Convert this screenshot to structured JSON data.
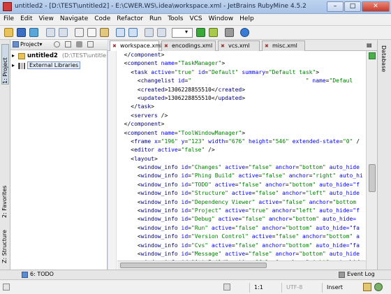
{
  "window": {
    "title": "untitled2 - [D:\\TEST\\untitled2] - E:\\CWER.WS\\.idea\\workspace.xml - JetBrains RubyMine 4.5.2",
    "min": "–",
    "max": "□",
    "close": "✕"
  },
  "menu": [
    "File",
    "Edit",
    "View",
    "Navigate",
    "Code",
    "Refactor",
    "Run",
    "Tools",
    "VCS",
    "Window",
    "Help"
  ],
  "project_panel": {
    "dropdown": "Project▾",
    "root_name": "untitled2",
    "root_path": "(D:\\TEST\\untitle",
    "libraries": "External Libraries"
  },
  "left_tabs": {
    "project": "1: Project",
    "favorites": "2: Favorites",
    "structure": "Z: Structure"
  },
  "right_tabs": {
    "database": "Database"
  },
  "editor_tabs": [
    "workspace.xml",
    "encodings.xml",
    "vcs.xml",
    "misc.xml"
  ],
  "code_lines": [
    [
      [
        "  </",
        ""
      ],
      [
        "component",
        "t"
      ],
      [
        ">",
        ""
      ]
    ],
    [
      [
        "  <",
        ""
      ],
      [
        "component",
        "t"
      ],
      [
        " ",
        ""
      ],
      [
        "name",
        "a"
      ],
      [
        "=",
        ""
      ],
      [
        "\"TaskManager\"",
        "v"
      ],
      [
        ">",
        ""
      ]
    ],
    [
      [
        "    <",
        ""
      ],
      [
        "task",
        "t"
      ],
      [
        " ",
        ""
      ],
      [
        "active",
        "a"
      ],
      [
        "=",
        ""
      ],
      [
        "\"true\"",
        "v"
      ],
      [
        " ",
        ""
      ],
      [
        "id",
        "a"
      ],
      [
        "=",
        ""
      ],
      [
        "\"Default\"",
        "v"
      ],
      [
        " ",
        ""
      ],
      [
        "summary",
        "a"
      ],
      [
        "=",
        ""
      ],
      [
        "\"Default task\"",
        "v"
      ],
      [
        ">",
        ""
      ]
    ],
    [
      [
        "      <",
        ""
      ],
      [
        "changelist",
        "t"
      ],
      [
        " ",
        ""
      ],
      [
        "id",
        "a"
      ],
      [
        "=",
        ""
      ],
      [
        "\"                                  \"",
        "v"
      ],
      [
        " ",
        ""
      ],
      [
        "name",
        "a"
      ],
      [
        "=",
        ""
      ],
      [
        "\"Defaul",
        "v"
      ]
    ],
    [
      [
        "      <",
        ""
      ],
      [
        "created",
        "t"
      ],
      [
        ">1306228855510</",
        ""
      ],
      [
        "created",
        "t"
      ],
      [
        ">",
        ""
      ]
    ],
    [
      [
        "      <",
        ""
      ],
      [
        "updated",
        "t"
      ],
      [
        ">1306228855510</",
        ""
      ],
      [
        "updated",
        "t"
      ],
      [
        ">",
        ""
      ]
    ],
    [
      [
        "    </",
        ""
      ],
      [
        "task",
        "t"
      ],
      [
        ">",
        ""
      ]
    ],
    [
      [
        "    <",
        ""
      ],
      [
        "servers",
        "t"
      ],
      [
        " />",
        ""
      ]
    ],
    [
      [
        "  </",
        ""
      ],
      [
        "component",
        "t"
      ],
      [
        ">",
        ""
      ]
    ],
    [
      [
        "  <",
        ""
      ],
      [
        "component",
        "t"
      ],
      [
        " ",
        ""
      ],
      [
        "name",
        "a"
      ],
      [
        "=",
        ""
      ],
      [
        "\"ToolWindowManager\"",
        "v"
      ],
      [
        ">",
        ""
      ]
    ],
    [
      [
        "    <",
        ""
      ],
      [
        "frame",
        "t"
      ],
      [
        " ",
        ""
      ],
      [
        "x",
        "a"
      ],
      [
        "=",
        ""
      ],
      [
        "\"196\"",
        "v"
      ],
      [
        " ",
        ""
      ],
      [
        "y",
        "a"
      ],
      [
        "=",
        ""
      ],
      [
        "\"123\"",
        "v"
      ],
      [
        " ",
        ""
      ],
      [
        "width",
        "a"
      ],
      [
        "=",
        ""
      ],
      [
        "\"676\"",
        "v"
      ],
      [
        " ",
        ""
      ],
      [
        "height",
        "a"
      ],
      [
        "=",
        ""
      ],
      [
        "\"546\"",
        "v"
      ],
      [
        " ",
        ""
      ],
      [
        "extended-state",
        "a"
      ],
      [
        "=",
        ""
      ],
      [
        "\"0\"",
        "v"
      ],
      [
        " /",
        ""
      ]
    ],
    [
      [
        "    <",
        ""
      ],
      [
        "editor",
        "t"
      ],
      [
        " ",
        ""
      ],
      [
        "active",
        "a"
      ],
      [
        "=",
        ""
      ],
      [
        "\"false\"",
        "v"
      ],
      [
        " />",
        ""
      ]
    ],
    [
      [
        "    <",
        ""
      ],
      [
        "layout",
        "t"
      ],
      [
        ">",
        ""
      ]
    ],
    [
      [
        "      <",
        ""
      ],
      [
        "window_info",
        "t"
      ],
      [
        " ",
        ""
      ],
      [
        "id",
        "a"
      ],
      [
        "=",
        ""
      ],
      [
        "\"Changes\"",
        "v"
      ],
      [
        " ",
        ""
      ],
      [
        "active",
        "a"
      ],
      [
        "=",
        ""
      ],
      [
        "\"false\"",
        "v"
      ],
      [
        " ",
        ""
      ],
      [
        "anchor",
        "a"
      ],
      [
        "=",
        ""
      ],
      [
        "\"bottom\"",
        "v"
      ],
      [
        " ",
        ""
      ],
      [
        "auto_hide",
        "a"
      ]
    ],
    [
      [
        "      <",
        ""
      ],
      [
        "window_info",
        "t"
      ],
      [
        " ",
        ""
      ],
      [
        "id",
        "a"
      ],
      [
        "=",
        ""
      ],
      [
        "\"Phing Build\"",
        "v"
      ],
      [
        " ",
        ""
      ],
      [
        "active",
        "a"
      ],
      [
        "=",
        ""
      ],
      [
        "\"false\"",
        "v"
      ],
      [
        " ",
        ""
      ],
      [
        "anchor",
        "a"
      ],
      [
        "=",
        ""
      ],
      [
        "\"right\"",
        "v"
      ],
      [
        " ",
        ""
      ],
      [
        "auto_hi",
        "a"
      ]
    ],
    [
      [
        "      <",
        ""
      ],
      [
        "window_info",
        "t"
      ],
      [
        " ",
        ""
      ],
      [
        "id",
        "a"
      ],
      [
        "=",
        ""
      ],
      [
        "\"TODO\"",
        "v"
      ],
      [
        " ",
        ""
      ],
      [
        "active",
        "a"
      ],
      [
        "=",
        ""
      ],
      [
        "\"false\"",
        "v"
      ],
      [
        " ",
        ""
      ],
      [
        "anchor",
        "a"
      ],
      [
        "=",
        ""
      ],
      [
        "\"bottom\"",
        "v"
      ],
      [
        " ",
        ""
      ],
      [
        "auto_hide=\"f",
        "a"
      ]
    ],
    [
      [
        "      <",
        ""
      ],
      [
        "window_info",
        "t"
      ],
      [
        " ",
        ""
      ],
      [
        "id",
        "a"
      ],
      [
        "=",
        ""
      ],
      [
        "\"Structure\"",
        "v"
      ],
      [
        " ",
        ""
      ],
      [
        "active",
        "a"
      ],
      [
        "=",
        ""
      ],
      [
        "\"false\"",
        "v"
      ],
      [
        " ",
        ""
      ],
      [
        "anchor",
        "a"
      ],
      [
        "=",
        ""
      ],
      [
        "\"left\"",
        "v"
      ],
      [
        " ",
        ""
      ],
      [
        "auto_hide",
        "a"
      ]
    ],
    [
      [
        "      <",
        ""
      ],
      [
        "window_info",
        "t"
      ],
      [
        " ",
        ""
      ],
      [
        "id",
        "a"
      ],
      [
        "=",
        ""
      ],
      [
        "\"Dependency Viewer\"",
        "v"
      ],
      [
        " ",
        ""
      ],
      [
        "active",
        "a"
      ],
      [
        "=",
        ""
      ],
      [
        "\"false\"",
        "v"
      ],
      [
        " ",
        ""
      ],
      [
        "anchor",
        "a"
      ],
      [
        "=",
        ""
      ],
      [
        "\"bottom",
        "v"
      ]
    ],
    [
      [
        "      <",
        ""
      ],
      [
        "window_info",
        "t"
      ],
      [
        " ",
        ""
      ],
      [
        "id",
        "a"
      ],
      [
        "=",
        ""
      ],
      [
        "\"Project\"",
        "v"
      ],
      [
        " ",
        ""
      ],
      [
        "active",
        "a"
      ],
      [
        "=",
        ""
      ],
      [
        "\"true\"",
        "v"
      ],
      [
        " ",
        ""
      ],
      [
        "anchor",
        "a"
      ],
      [
        "=",
        ""
      ],
      [
        "\"left\"",
        "v"
      ],
      [
        " ",
        ""
      ],
      [
        "auto_hide=\"f",
        "a"
      ]
    ],
    [
      [
        "      <",
        ""
      ],
      [
        "window_info",
        "t"
      ],
      [
        " ",
        ""
      ],
      [
        "id",
        "a"
      ],
      [
        "=",
        ""
      ],
      [
        "\"Debug\"",
        "v"
      ],
      [
        " ",
        ""
      ],
      [
        "active",
        "a"
      ],
      [
        "=",
        ""
      ],
      [
        "\"false\"",
        "v"
      ],
      [
        " ",
        ""
      ],
      [
        "anchor",
        "a"
      ],
      [
        "=",
        ""
      ],
      [
        "\"bottom\"",
        "v"
      ],
      [
        " ",
        ""
      ],
      [
        "auto_hide=",
        "a"
      ]
    ],
    [
      [
        "      <",
        ""
      ],
      [
        "window_info",
        "t"
      ],
      [
        " ",
        ""
      ],
      [
        "id",
        "a"
      ],
      [
        "=",
        ""
      ],
      [
        "\"Run\"",
        "v"
      ],
      [
        " ",
        ""
      ],
      [
        "active",
        "a"
      ],
      [
        "=",
        ""
      ],
      [
        "\"false\"",
        "v"
      ],
      [
        " ",
        ""
      ],
      [
        "anchor",
        "a"
      ],
      [
        "=",
        ""
      ],
      [
        "\"bottom\"",
        "v"
      ],
      [
        " ",
        ""
      ],
      [
        "auto_hide=\"fa",
        "a"
      ]
    ],
    [
      [
        "      <",
        ""
      ],
      [
        "window_info",
        "t"
      ],
      [
        " ",
        ""
      ],
      [
        "id",
        "a"
      ],
      [
        "=",
        ""
      ],
      [
        "\"Version Control\"",
        "v"
      ],
      [
        " ",
        ""
      ],
      [
        "active",
        "a"
      ],
      [
        "=",
        ""
      ],
      [
        "\"false\"",
        "v"
      ],
      [
        " ",
        ""
      ],
      [
        "anchor",
        "a"
      ],
      [
        "=",
        ""
      ],
      [
        "\"bottom\"",
        "v"
      ],
      [
        " a",
        "a"
      ]
    ],
    [
      [
        "      <",
        ""
      ],
      [
        "window_info",
        "t"
      ],
      [
        " ",
        ""
      ],
      [
        "id",
        "a"
      ],
      [
        "=",
        ""
      ],
      [
        "\"Cvs\"",
        "v"
      ],
      [
        " ",
        ""
      ],
      [
        "active",
        "a"
      ],
      [
        "=",
        ""
      ],
      [
        "\"false\"",
        "v"
      ],
      [
        " ",
        ""
      ],
      [
        "anchor",
        "a"
      ],
      [
        "=",
        ""
      ],
      [
        "\"bottom\"",
        "v"
      ],
      [
        " ",
        ""
      ],
      [
        "auto_hide=\"fa",
        "a"
      ]
    ],
    [
      [
        "      <",
        ""
      ],
      [
        "window_info",
        "t"
      ],
      [
        " ",
        ""
      ],
      [
        "id",
        "a"
      ],
      [
        "=",
        ""
      ],
      [
        "\"Message\"",
        "v"
      ],
      [
        " ",
        ""
      ],
      [
        "active",
        "a"
      ],
      [
        "=",
        ""
      ],
      [
        "\"false\"",
        "v"
      ],
      [
        " ",
        ""
      ],
      [
        "anchor",
        "a"
      ],
      [
        "=",
        ""
      ],
      [
        "\"bottom\"",
        "v"
      ],
      [
        " ",
        ""
      ],
      [
        "auto_hide",
        "a"
      ]
    ],
    [
      [
        "      <",
        ""
      ],
      [
        "window_info",
        "t"
      ],
      [
        " ",
        ""
      ],
      [
        "id",
        "a"
      ],
      [
        "=",
        ""
      ],
      [
        "\"Ant Build\"",
        "v"
      ],
      [
        " ",
        ""
      ],
      [
        "active",
        "a"
      ],
      [
        "=",
        ""
      ],
      [
        "\"false\"",
        "v"
      ],
      [
        " ",
        ""
      ],
      [
        "anchor",
        "a"
      ],
      [
        "=",
        ""
      ],
      [
        "\"right\"",
        "v"
      ],
      [
        " ",
        ""
      ],
      [
        "auto_hide",
        "a"
      ]
    ]
  ],
  "bottom_tools": {
    "todo": "6: TODO",
    "event_log": "Event Log"
  },
  "status": {
    "position": "1:1",
    "encoding": "UTF-8",
    "mode": "Insert"
  },
  "colors": {
    "tag": "#000080",
    "attr": "#0000ff",
    "value": "#008000"
  }
}
